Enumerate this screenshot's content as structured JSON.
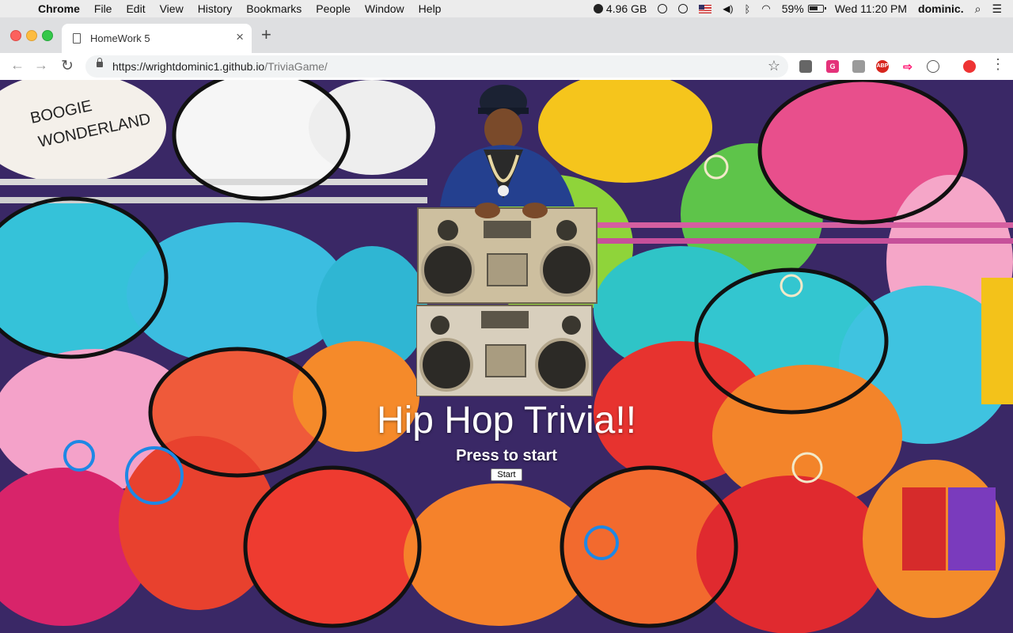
{
  "menubar": {
    "app_name": "Chrome",
    "items": [
      "File",
      "Edit",
      "View",
      "History",
      "Bookmarks",
      "People",
      "Window",
      "Help"
    ],
    "memory": "4.96 GB",
    "battery": "59%",
    "datetime": "Wed 11:20 PM",
    "user": "dominic."
  },
  "browser": {
    "tab_title": "HomeWork 5",
    "url_host": "https://wrightdominic1.github.io",
    "url_path": "/TriviaGame/",
    "extensions": [
      "extension-1",
      "grammarly",
      "extension-3",
      "ABP",
      "extension-5",
      "extension-6",
      "extension-7"
    ]
  },
  "page": {
    "heading": "Hip Hop Trivia!!",
    "subheading": "Press to start",
    "start_label": "Start"
  }
}
